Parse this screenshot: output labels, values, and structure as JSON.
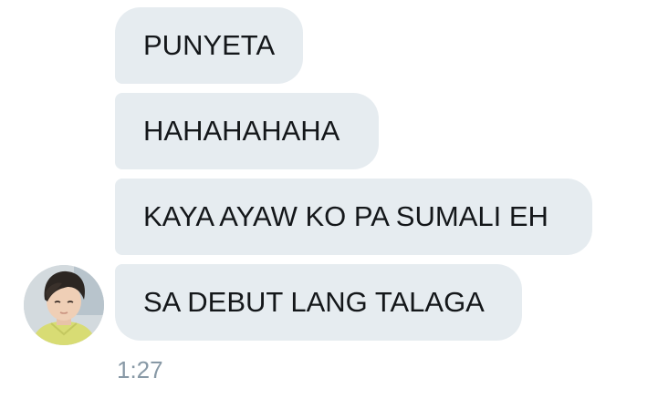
{
  "conversation": {
    "messages": [
      {
        "text": "PUNYETA"
      },
      {
        "text": "HAHAHAHAHA"
      },
      {
        "text": "KAYA AYAW KO PA SUMALI EH"
      },
      {
        "text": "SA DEBUT LANG TALAGA"
      }
    ],
    "timestamp": "1:27",
    "sender": {
      "avatar_icon": "user-avatar-photo"
    }
  },
  "colors": {
    "bubble_background": "#e6ecf0",
    "message_text": "#14171a",
    "timestamp_text": "#8899a6",
    "page_background": "#ffffff"
  }
}
